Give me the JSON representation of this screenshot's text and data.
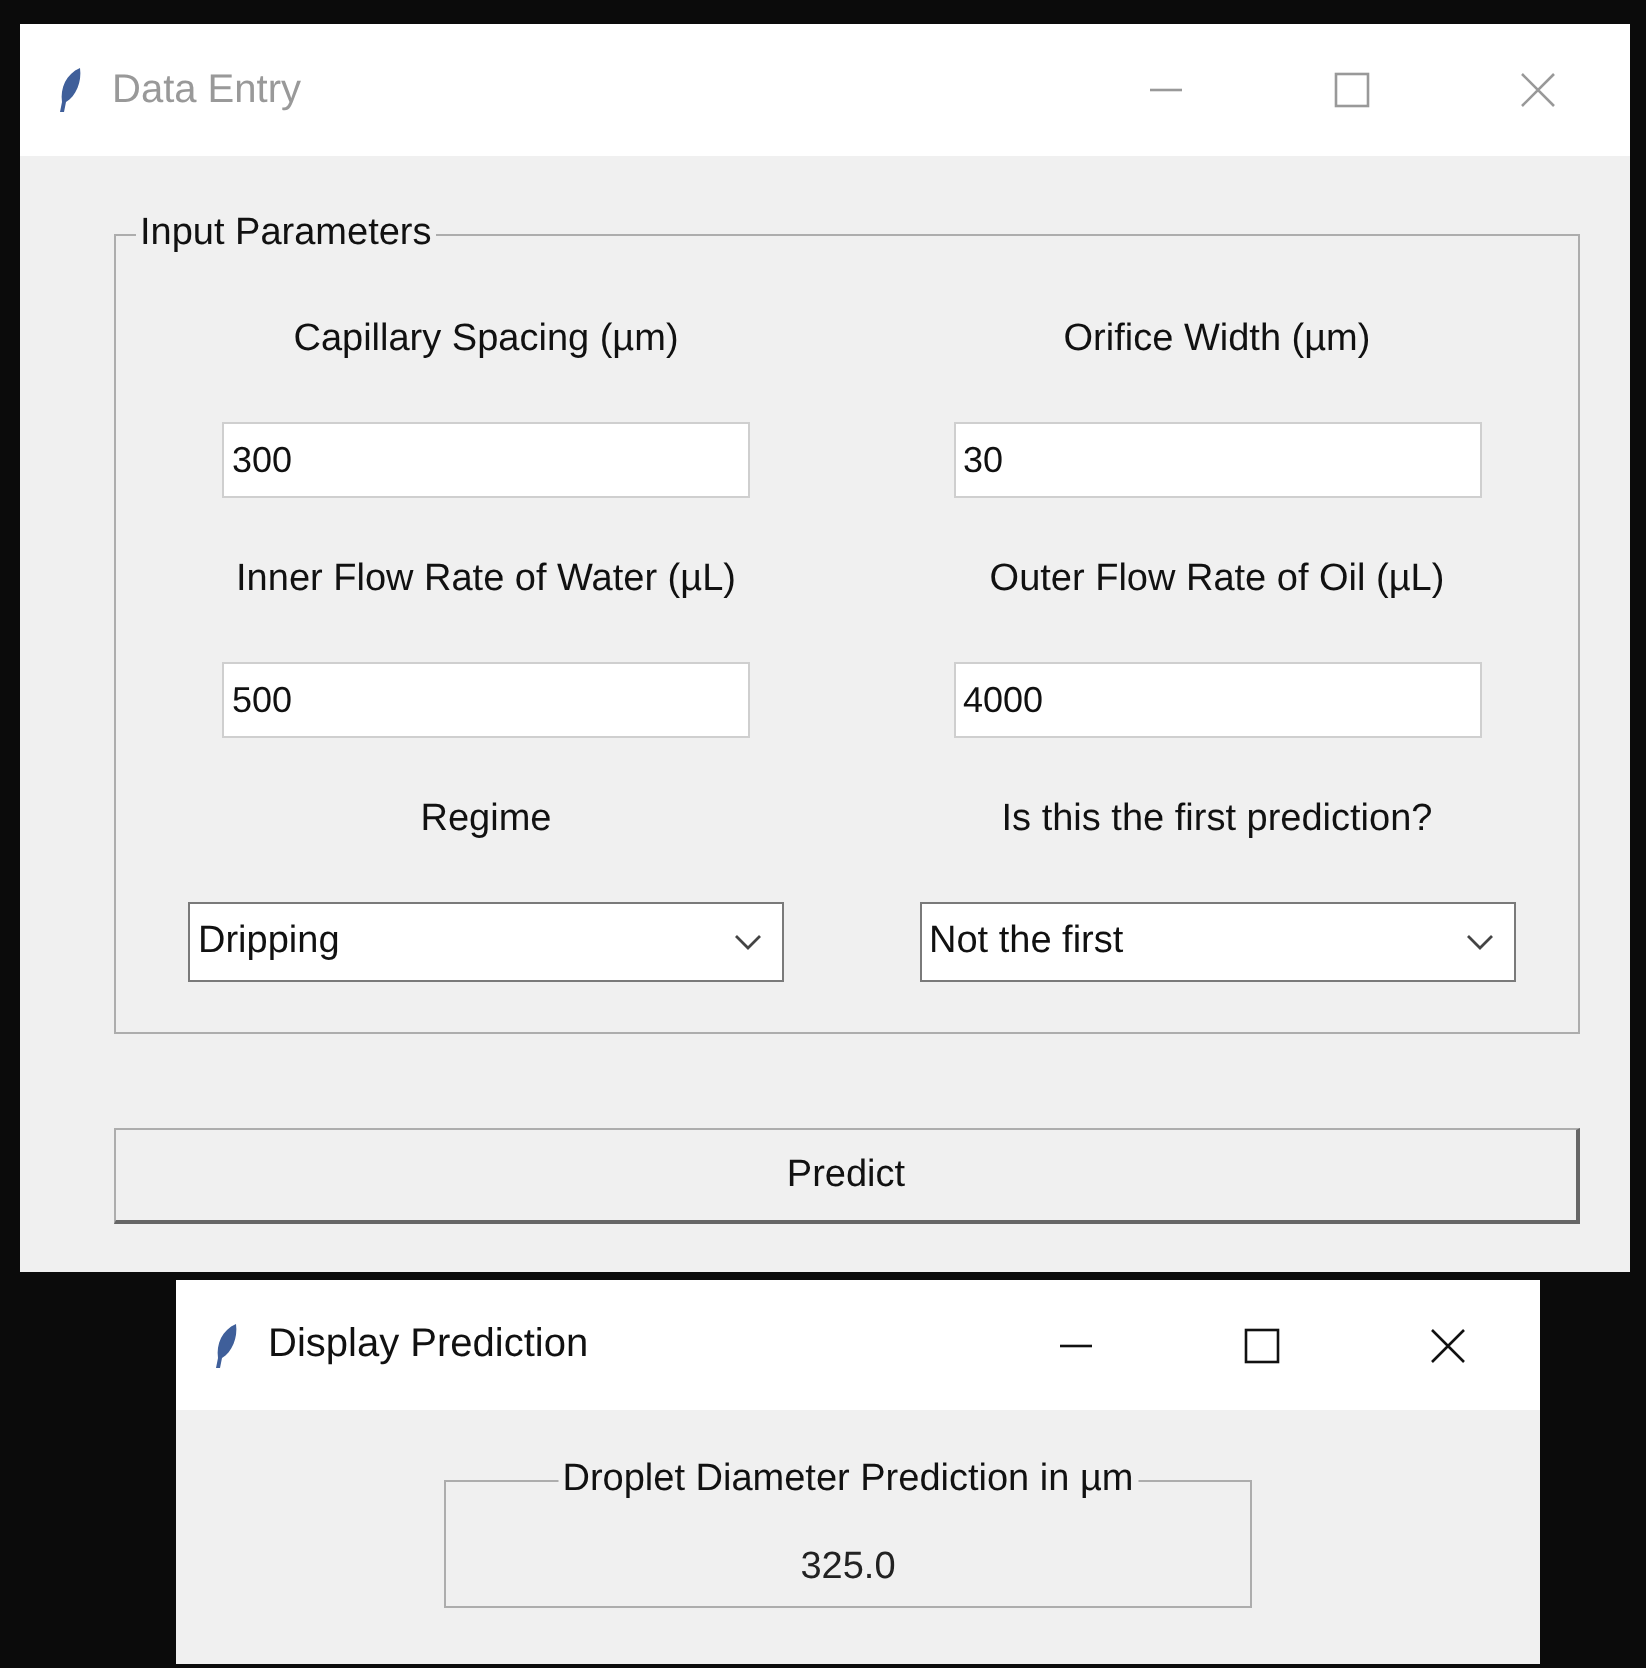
{
  "main_window": {
    "title": "Data Entry",
    "active": false,
    "group": {
      "title": "Input Parameters",
      "fields": [
        {
          "label": "Capillary Spacing (µm)",
          "kind": "entry",
          "value": "300"
        },
        {
          "label": "Orifice Width (µm)",
          "kind": "entry",
          "value": "30"
        },
        {
          "label": "Inner Flow Rate of Water (µL)",
          "kind": "entry",
          "value": "500"
        },
        {
          "label": "Outer Flow Rate of Oil (µL)",
          "kind": "entry",
          "value": "4000"
        },
        {
          "label": "Regime",
          "kind": "combo",
          "value": "Dripping"
        },
        {
          "label": "Is this the first prediction?",
          "kind": "combo",
          "value": "Not the first"
        }
      ]
    },
    "button": "Predict"
  },
  "prediction_window": {
    "title": "Display Prediction",
    "active": true,
    "group": {
      "title": "Droplet Diameter Prediction in µm",
      "value": "325.0"
    }
  }
}
